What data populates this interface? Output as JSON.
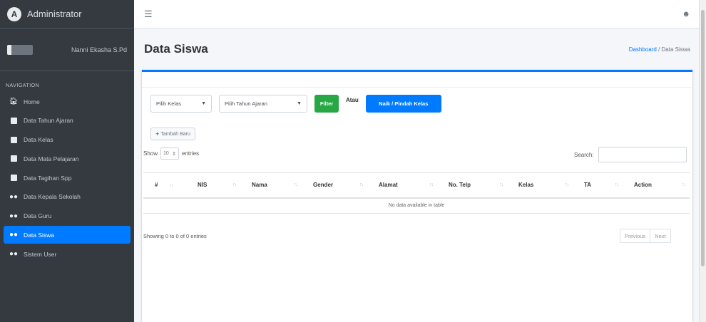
{
  "sidebar": {
    "brand": "Administrator",
    "brand_logo": "A",
    "user_name": "Nanni Ekasha S.Pd",
    "nav_header": "NAVIGATION",
    "items": [
      {
        "label": "Home",
        "icon": "home-icon"
      },
      {
        "label": "Data Tahun Ajaran",
        "icon": "book-icon"
      },
      {
        "label": "Data Kelas",
        "icon": "book-icon"
      },
      {
        "label": "Data Mata Pelajaran",
        "icon": "book-icon"
      },
      {
        "label": "Data Tagihan Spp",
        "icon": "book-icon"
      },
      {
        "label": "Data Kepala Sekolah",
        "icon": "users-icon"
      },
      {
        "label": "Data Guru",
        "icon": "users-icon"
      },
      {
        "label": "Data Siswa",
        "icon": "users-icon",
        "active": true
      },
      {
        "label": "Sistem User",
        "icon": "users-icon"
      }
    ]
  },
  "topbar": {
    "menu_icon": "hamburger-icon",
    "user_icon": "user-icon"
  },
  "header": {
    "title": "Data Siswa",
    "breadcrumb": {
      "home": "Dashboard",
      "separator": "/",
      "current": "Data Siswa"
    }
  },
  "filters": {
    "kelas_placeholder": "Pilih Kelas",
    "tahun_placeholder": "Pilih Tahun Ajaran",
    "filter_button": "Filter",
    "atau": "Atau",
    "naik_button": "Naik / Pindah Kelas"
  },
  "tambah_button": "Tambah Baru",
  "datatable": {
    "show_label": "Show",
    "entries_value": "10",
    "entries_label": "entries",
    "search_label": "Search:",
    "columns": [
      "#",
      "NIS",
      "Nama",
      "Gender",
      "Alamat",
      "No. Telp",
      "Kelas",
      "TA",
      "Action"
    ],
    "empty_message": "No data available in table",
    "info": "Showing 0 to 0 of 0 entries",
    "previous": "Previous",
    "next": "Next"
  },
  "colors": {
    "sidebar_bg": "#343a40",
    "primary": "#007bff",
    "success": "#28a745"
  }
}
